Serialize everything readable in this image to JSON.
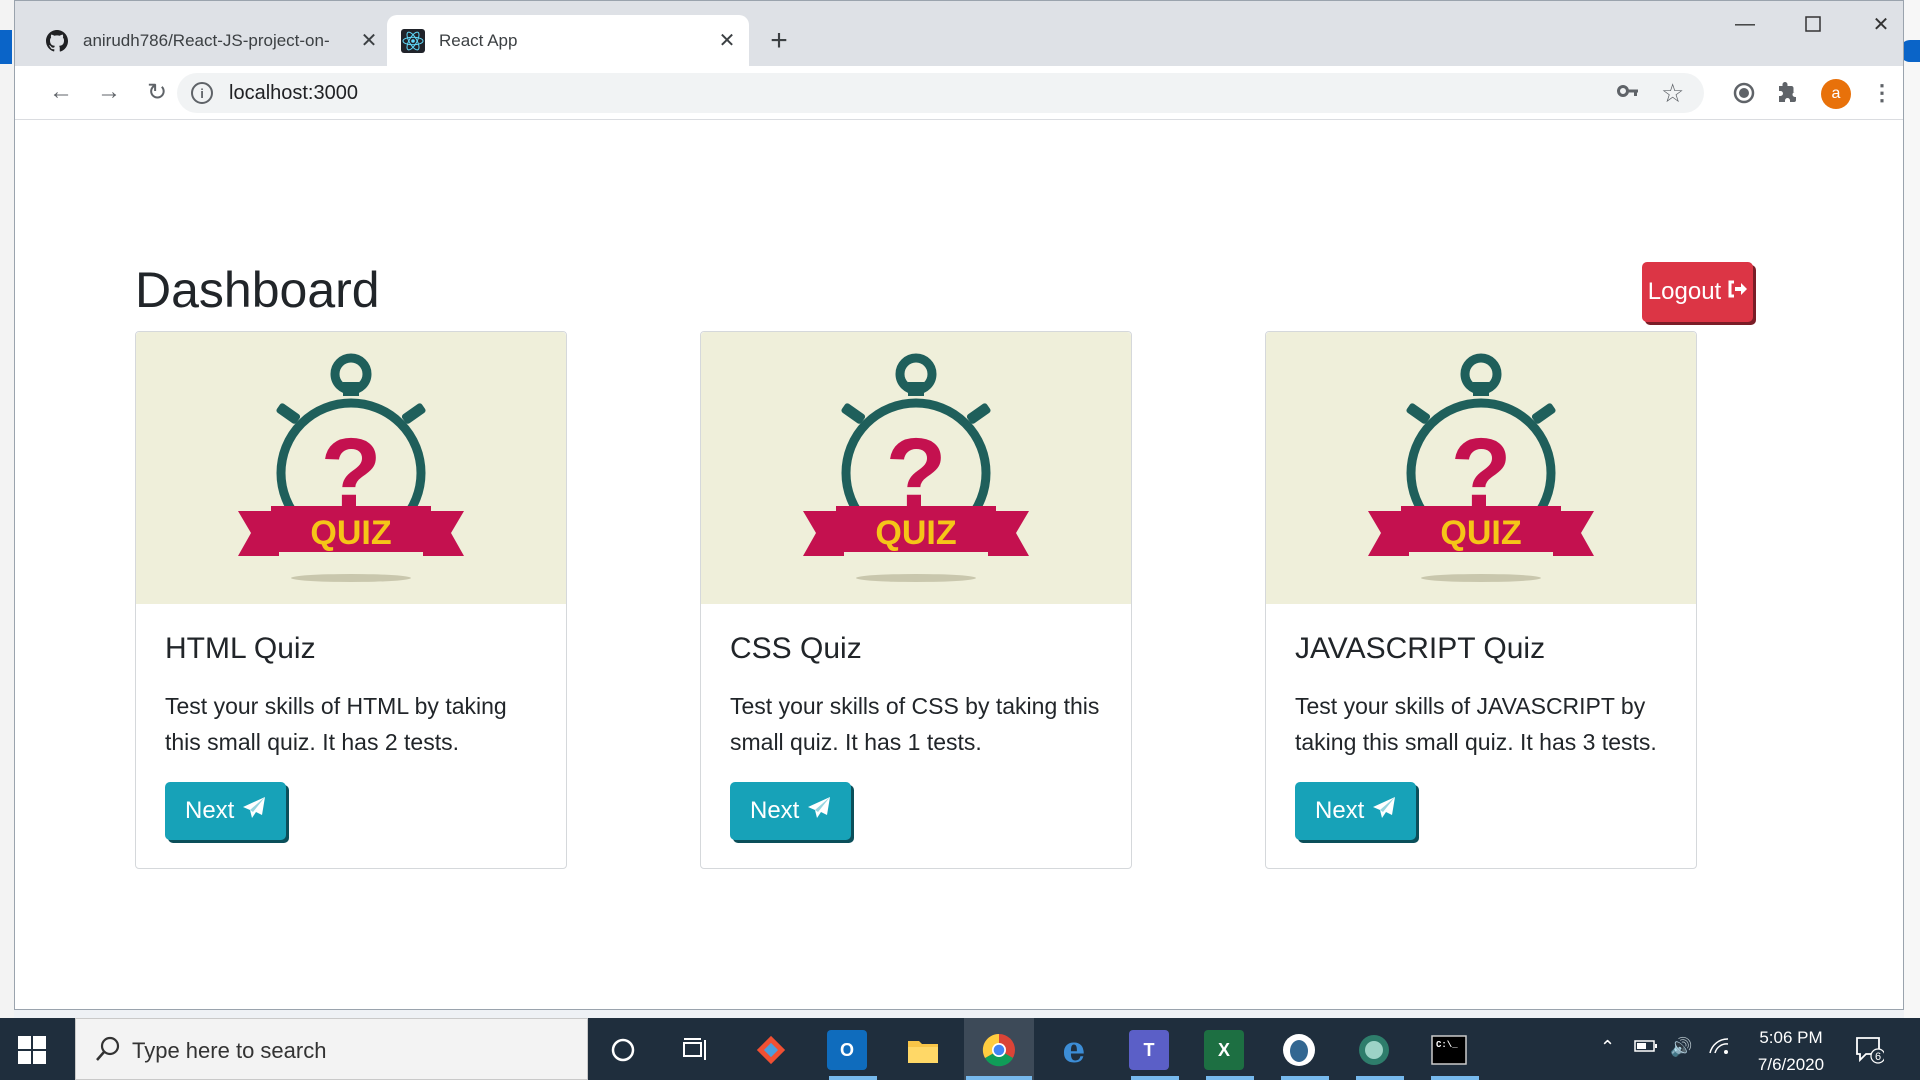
{
  "browser": {
    "tabs": [
      {
        "title": "anirudh786/React-JS-project-on-",
        "icon": "github-icon",
        "active": false
      },
      {
        "title": "React App",
        "icon": "react-icon",
        "active": true
      }
    ],
    "url": "localhost:3000",
    "profile_initial": "a"
  },
  "page": {
    "title": "Dashboard",
    "logout_label": "Logout",
    "cards": [
      {
        "image_text": "QUIZ",
        "title": "HTML Quiz",
        "description": "Test your skills of HTML by taking this small quiz. It has 2 tests.",
        "button_label": "Next"
      },
      {
        "image_text": "QUIZ",
        "title": "CSS Quiz",
        "description": "Test your skills of CSS by taking this small quiz. It has 1 tests.",
        "button_label": "Next"
      },
      {
        "image_text": "QUIZ",
        "title": "JAVASCRIPT Quiz",
        "description": "Test your skills of JAVASCRIPT by taking this small quiz. It has 3 tests.",
        "button_label": "Next"
      }
    ],
    "colors": {
      "logout": "#dc3545",
      "next": "#17a2b8",
      "quiz_banner": "#c4114f",
      "quiz_ring": "#1f5f5b",
      "quiz_text": "#f5c518"
    }
  },
  "taskbar": {
    "search_placeholder": "Type here to search",
    "time": "5:06 PM",
    "date": "7/6/2020",
    "notification_count": "6"
  }
}
